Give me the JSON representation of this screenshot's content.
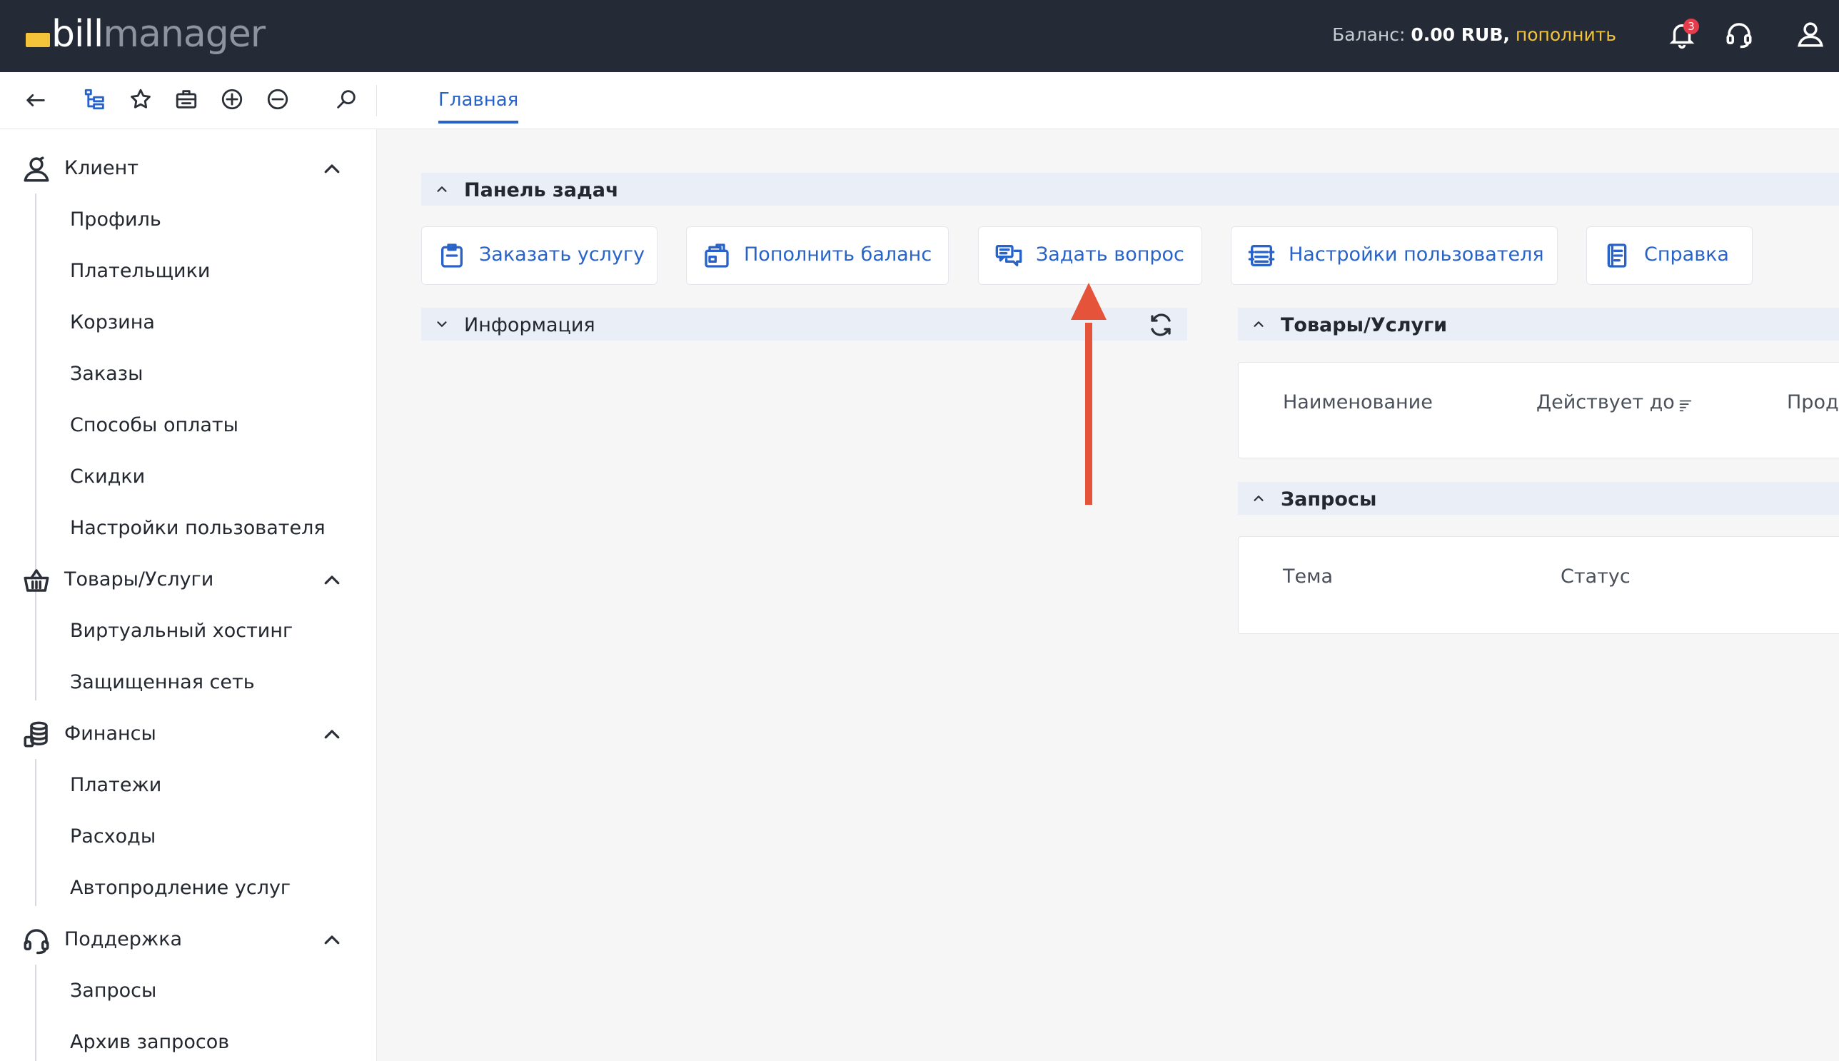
{
  "header": {
    "logo_bill": "bill",
    "logo_manager": "manager",
    "balance_label": "Баланс:",
    "balance_amount": "0.00 RUB,",
    "balance_topup": "пополнить",
    "notifications_count": "3",
    "icons": [
      "bell-icon",
      "support-headset-icon",
      "user-account-icon"
    ],
    "accent_color": "#f3c33a",
    "bg_color": "#252b36"
  },
  "toolbar": {
    "icons": [
      "back-arrow-icon",
      "tree-view-icon",
      "star-icon",
      "briefcase-icon",
      "plus-circle-icon",
      "minus-circle-icon",
      "search-icon"
    ],
    "active_tab": "Главная"
  },
  "sidebar": {
    "groups": [
      {
        "label": "Клиент",
        "icon": "client-user-icon",
        "items": [
          "Профиль",
          "Плательщики",
          "Корзина",
          "Заказы",
          "Способы оплаты",
          "Скидки",
          "Настройки пользователя"
        ]
      },
      {
        "label": "Товары/Услуги",
        "icon": "basket-icon",
        "items": [
          "Виртуальный хостинг",
          "Защищенная сеть"
        ]
      },
      {
        "label": "Финансы",
        "icon": "coins-icon",
        "items": [
          "Платежи",
          "Расходы",
          "Автопродление услуг"
        ]
      },
      {
        "label": "Поддержка",
        "icon": "headset-icon",
        "items": [
          "Запросы",
          "Архив запросов"
        ]
      }
    ]
  },
  "main": {
    "task_panel_title": "Панель задач",
    "task_buttons": [
      {
        "label": "Заказать услугу",
        "icon": "order-clipboard-icon"
      },
      {
        "label": "Пополнить баланс",
        "icon": "wallet-icon"
      },
      {
        "label": "Задать вопрос",
        "icon": "chat-bubbles-icon"
      },
      {
        "label": "Настройки пользователя",
        "icon": "settings-list-icon"
      },
      {
        "label": "Справка",
        "icon": "help-document-icon"
      }
    ],
    "info_title": "Информация",
    "products_title": "Товары/Услуги",
    "products_columns": [
      "Наименование",
      "Действует до",
      "Прод"
    ],
    "requests_title": "Запросы",
    "requests_columns": [
      "Тема",
      "Статус"
    ],
    "link_color": "#2763c9",
    "annotation_arrow_color": "#e5533a"
  }
}
